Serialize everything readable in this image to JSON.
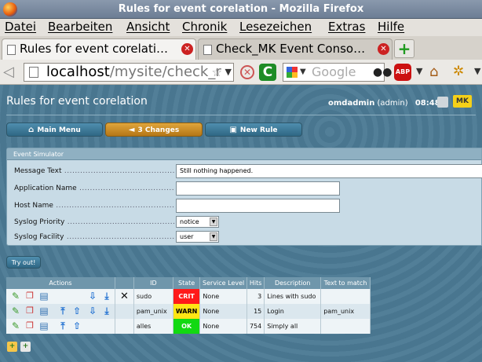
{
  "window": {
    "title": "Rules for event corelation - Mozilla Firefox"
  },
  "menu": {
    "items": [
      "Datei",
      "Bearbeiten",
      "Ansicht",
      "Chronik",
      "Lesezeichen",
      "Extras",
      "Hilfe"
    ]
  },
  "tabs": [
    {
      "label": "Rules for event corelati…"
    },
    {
      "label": "Check_MK Event Conso…"
    }
  ],
  "nav": {
    "url_host": "localhost",
    "url_path": "/mysite/check_r",
    "search_placeholder": "Google",
    "abp_label": "ABP"
  },
  "page": {
    "title": "Rules for event corelation",
    "user": "omdadmin",
    "role": "(admin)",
    "time": "08:48",
    "logo_text": "MK"
  },
  "buttons": {
    "main_menu": "Main Menu",
    "changes": "3 Changes",
    "new_rule": "New Rule",
    "try_out": "Try out!"
  },
  "simulator": {
    "title": "Event Simulator",
    "fields": {
      "message_label": "Message Text",
      "message_value": "Still nothing happened.",
      "application_label": "Application Name",
      "application_value": "",
      "host_label": "Host Name",
      "host_value": "",
      "priority_label": "Syslog Priority",
      "priority_value": "notice",
      "facility_label": "Syslog Facility",
      "facility_value": "user"
    }
  },
  "table": {
    "headers": {
      "actions": "Actions",
      "id": "ID",
      "state": "State",
      "service_level": "Service Level",
      "hits": "Hits",
      "description": "Description",
      "text_to_match": "Text to match"
    },
    "rows": [
      {
        "id": "sudo",
        "state": "CRIT",
        "service_level": "None",
        "hits": "3",
        "description": "Lines with sudo",
        "text_to_match": ""
      },
      {
        "id": "pam_unix",
        "state": "WARN",
        "service_level": "None",
        "hits": "15",
        "description": "Login",
        "text_to_match": "pam_unix"
      },
      {
        "id": "alles",
        "state": "OK",
        "service_level": "None",
        "hits": "754",
        "description": "Simply all",
        "text_to_match": ""
      }
    ]
  },
  "colors": {
    "crit": "#ff1a1a",
    "warn": "#ffe515",
    "ok": "#12d912",
    "background": "#4b7a94",
    "changes_button": "#d4952a"
  }
}
